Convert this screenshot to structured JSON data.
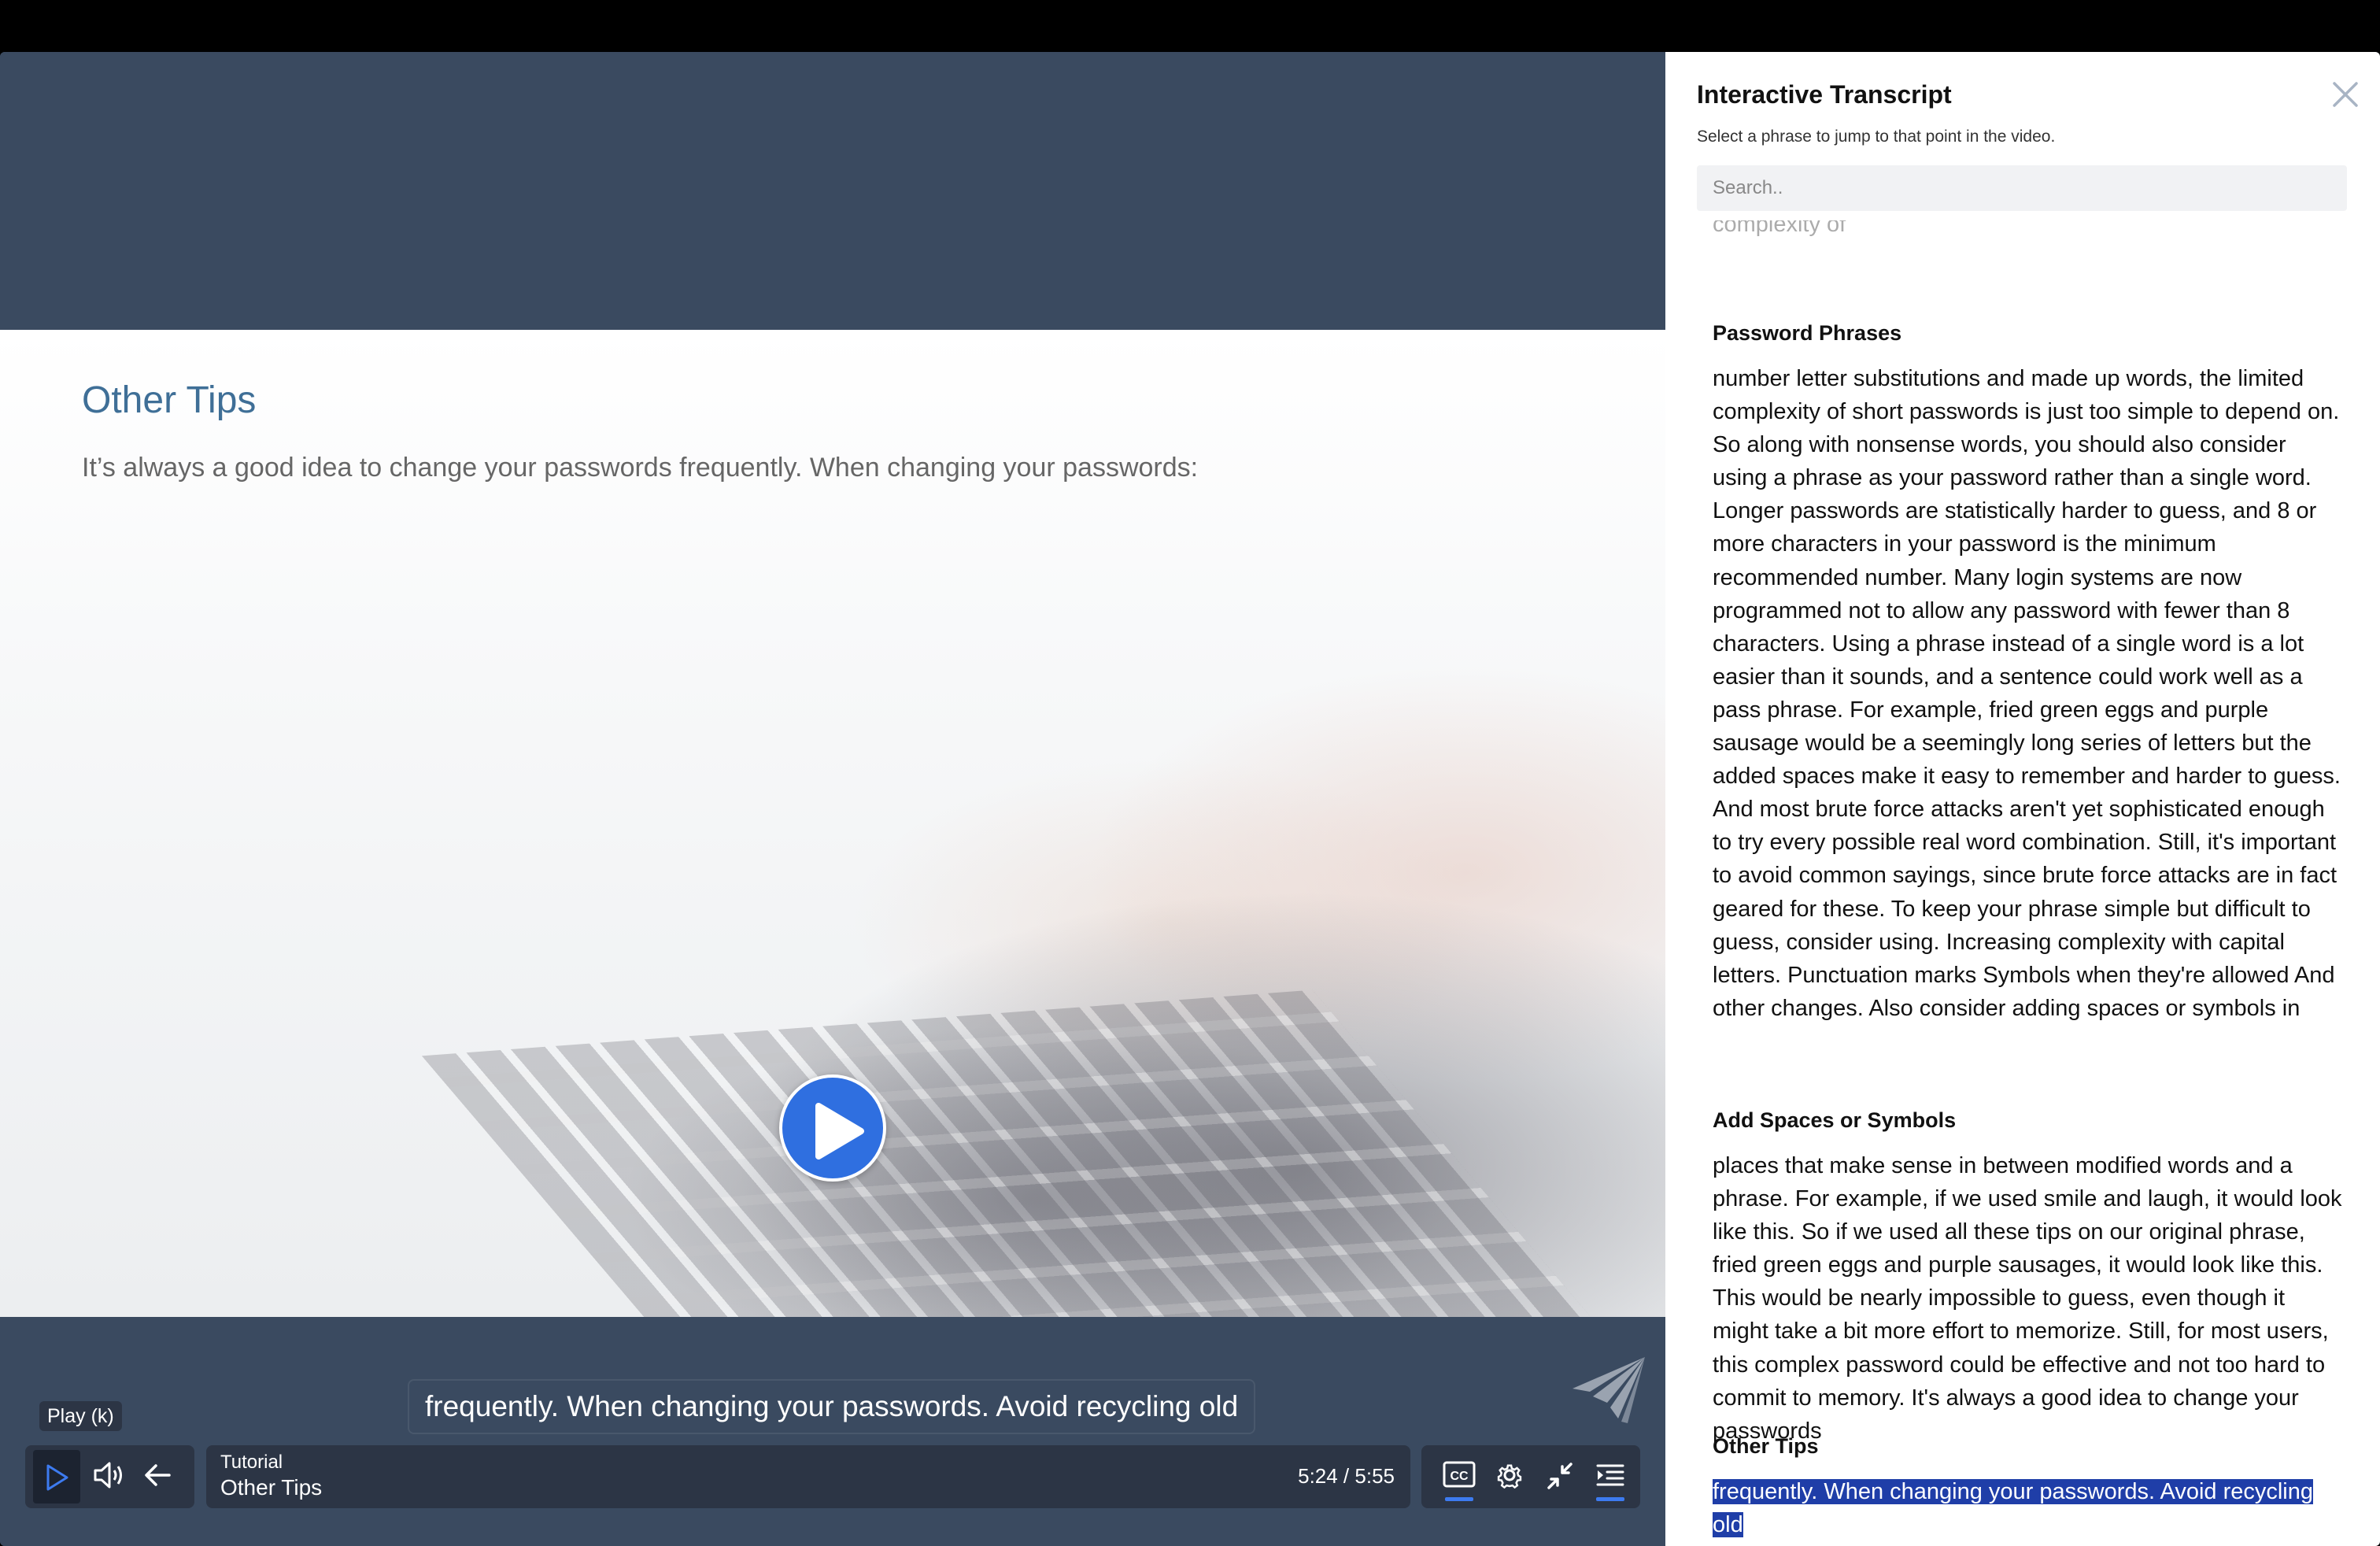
{
  "slide": {
    "title": "Other Tips",
    "text": "It’s always a good idea to change your passwords frequently. When changing your passwords:"
  },
  "player": {
    "caption": "frequently. When changing your passwords. Avoid recycling old",
    "tooltip": "Play (k)",
    "chapter_label": "Tutorial",
    "chapter_name": "Other Tips",
    "time": "5:24 / 5:55",
    "icons": [
      "play-icon",
      "volume-icon",
      "back-arrow-icon",
      "closed-captions-icon",
      "settings-gear-icon",
      "minimize-icon",
      "transcript-icon",
      "brand-logo-icon"
    ]
  },
  "transcript": {
    "title": "Interactive Transcript",
    "subtitle": "Select a phrase to jump to that point in the video.",
    "search_placeholder": "Search..",
    "cut_text": "complexity of",
    "sections": [
      {
        "title": "Password Phrases",
        "body": "number letter substitutions and made up words, the limited complexity of short passwords is just too simple to depend on. So along with nonsense words, you should also consider using a phrase as your password rather than a single word. Longer passwords are statistically harder to guess, and 8 or more characters in your password is the minimum recommended number. Many login systems are now programmed not to allow any password with fewer than 8 characters. Using a phrase instead of a single word is a lot easier than it sounds, and a sentence could work well as a pass phrase. For example, fried green eggs and purple sausage would be a seemingly long series of letters but the added spaces make it easy to remember and harder to guess. And most brute force attacks aren't yet sophisticated enough to try every possible real word combination. Still, it's important to avoid common sayings, since brute force attacks are in fact geared for these. To keep your phrase simple but difficult to guess, consider using. Increasing complexity with capital letters. Punctuation marks Symbols when they're allowed And other changes. Also consider adding spaces or symbols in"
      },
      {
        "title": "Add Spaces or Symbols",
        "body": "places that make sense in between modified words and a phrase. For example, if we used smile and laugh, it would look like this. So if we used all these tips on our original phrase, fried green eggs and purple sausages, it would look like this. This would be nearly impossible to guess, even though it might take a bit more effort to memorize. Still, for most users, this complex password could be effective and not too hard to commit to memory. It's always a good idea to change your passwords"
      },
      {
        "title": "Other Tips",
        "body": "frequently. When changing your passwords. Avoid recycling old"
      }
    ],
    "highlight_color": "#1f3ea8"
  },
  "colors": {
    "accent": "#2f6fe0",
    "frame": "#3a4a60",
    "controls": "#2c3545",
    "underline": "#3d7bf0"
  }
}
